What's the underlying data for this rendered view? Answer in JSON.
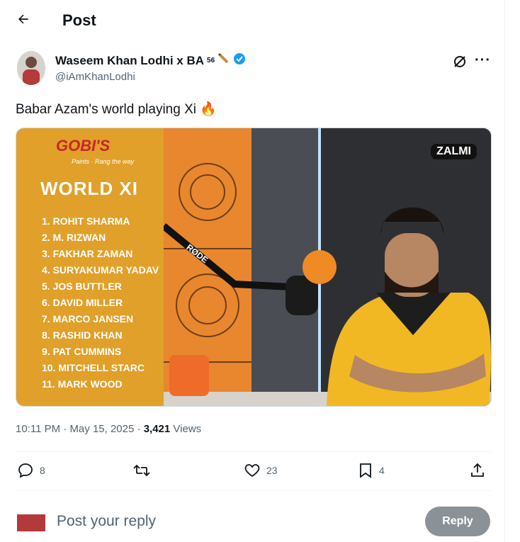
{
  "header": {
    "title": "Post"
  },
  "author": {
    "name": "Waseem Khan Lodhi x BA",
    "superscript": "56",
    "handle": "@iAmKhanLodhi"
  },
  "tweet": {
    "text": "Babar Azam's world playing Xi 🔥"
  },
  "media": {
    "logo": "GOBI'S",
    "logo_sub": "Paints · Rang the way",
    "panel_title": "WORLD XI",
    "players": [
      "1. ROHIT SHARMA",
      "2. M. RIZWAN",
      "3. FAKHAR ZAMAN",
      "4. SURYAKUMAR YADAV",
      "5. JOS BUTTLER",
      "6. DAVID MILLER",
      "7. MARCO JANSEN",
      "8. RASHID KHAN",
      "9. PAT CUMMINS",
      "10. MITCHELL STARC",
      "11. MARK WOOD"
    ],
    "mic_brand": "RØDE",
    "channel_badge": "ZALMI"
  },
  "meta": {
    "time": "10:11 PM",
    "date": "May 15, 2025",
    "views_count": "3,421",
    "views_label": "Views"
  },
  "actions": {
    "replies": "8",
    "likes": "23",
    "bookmarks": "4"
  },
  "reply": {
    "placeholder": "Post your reply",
    "button": "Reply"
  }
}
